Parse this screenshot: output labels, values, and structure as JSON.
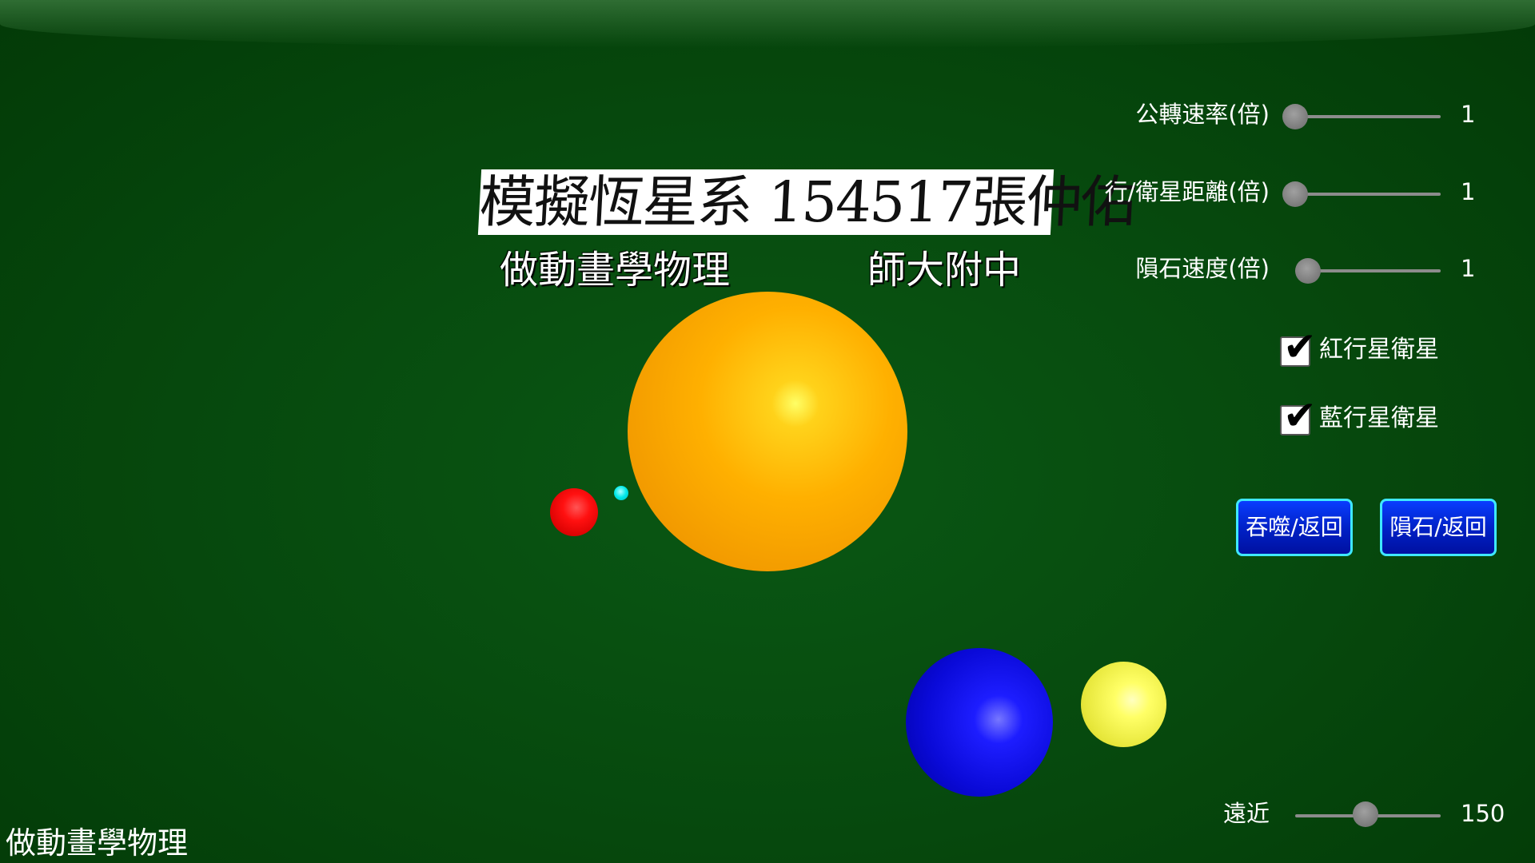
{
  "header": {
    "title": "模擬恆星系 154517張仲佑",
    "subtitle_left": "做動畫學物理",
    "subtitle_right": "師大附中"
  },
  "footer": {
    "label": "做動畫學物理"
  },
  "controls": {
    "orbit_speed": {
      "label": "公轉速率(倍)",
      "value": "1"
    },
    "planet_moon_distance": {
      "label": "行/衛星距離(倍)",
      "value": "1"
    },
    "meteor_speed": {
      "label": "隕石速度(倍)",
      "value": "1"
    },
    "red_planet_moon": {
      "label": "紅行星衛星",
      "checked": true
    },
    "blue_planet_moon": {
      "label": "藍行星衛星",
      "checked": true
    },
    "swallow_button": {
      "label": "吞噬/返回"
    },
    "meteor_button": {
      "label": "隕石/返回"
    },
    "zoom": {
      "label": "遠近",
      "value": "150"
    }
  },
  "icons": {
    "check": "checkmark-icon"
  },
  "colors": {
    "background": "#05430a",
    "star": "#ffb000",
    "red_planet": "#ff1010",
    "red_moon": "#00e8e8",
    "blue_planet": "#0a0ad8",
    "yellow_moon": "#ffff66",
    "button_fill": "#0022c8",
    "button_border": "#3fe8ff"
  }
}
